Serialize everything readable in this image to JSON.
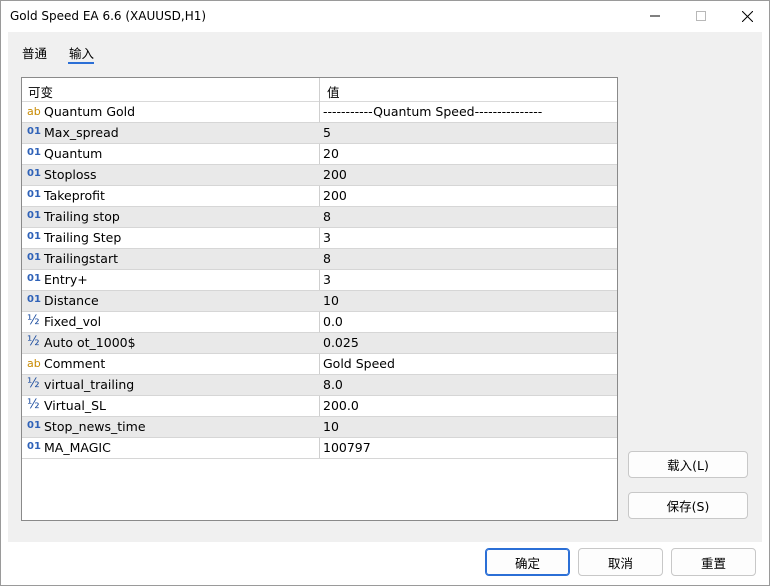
{
  "window": {
    "title": "Gold Speed EA 6.6 (XAUUSD,H1)"
  },
  "tabs": [
    {
      "label": "普通"
    },
    {
      "label": "输入"
    }
  ],
  "grid": {
    "headers": {
      "variable": "可变",
      "value": "值"
    },
    "rows": [
      {
        "type": "ab",
        "icon": "ab",
        "name": "Quantum Gold",
        "value": "-----------Quantum Speed---------------"
      },
      {
        "type": "int",
        "icon": "01",
        "name": "Max_spread",
        "value": "5"
      },
      {
        "type": "int",
        "icon": "01",
        "name": "Quantum",
        "value": "20"
      },
      {
        "type": "int",
        "icon": "01",
        "name": "Stoploss",
        "value": "200"
      },
      {
        "type": "int",
        "icon": "01",
        "name": "Takeprofit",
        "value": "200"
      },
      {
        "type": "int",
        "icon": "01",
        "name": "Trailing stop",
        "value": "8"
      },
      {
        "type": "int",
        "icon": "01",
        "name": "Trailing Step",
        "value": "3"
      },
      {
        "type": "int",
        "icon": "01",
        "name": "Trailingstart",
        "value": "8"
      },
      {
        "type": "int",
        "icon": "01",
        "name": "Entry+",
        "value": "3"
      },
      {
        "type": "int",
        "icon": "01",
        "name": "Distance",
        "value": "10"
      },
      {
        "type": "double",
        "icon": "½",
        "name": "Fixed_vol",
        "value": "0.0"
      },
      {
        "type": "double",
        "icon": "½",
        "name": "Auto ot_1000$",
        "value": "0.025"
      },
      {
        "type": "ab",
        "icon": "ab",
        "name": "Comment",
        "value": "Gold Speed"
      },
      {
        "type": "double",
        "icon": "½",
        "name": "virtual_trailing",
        "value": "8.0"
      },
      {
        "type": "double",
        "icon": "½",
        "name": "Virtual_SL",
        "value": "200.0"
      },
      {
        "type": "int",
        "icon": "01",
        "name": "Stop_news_time",
        "value": "10"
      },
      {
        "type": "int",
        "icon": "01",
        "name": "MA_MAGIC",
        "value": "100797"
      }
    ]
  },
  "side_buttons": {
    "load": "载入(L)",
    "save": "保存(S)"
  },
  "footer_buttons": {
    "ok": "确定",
    "cancel": "取消",
    "reset": "重置"
  },
  "colors": {
    "accent": "#2b6fd6",
    "alt_row": "#e9e9e9",
    "int_icon": "#2f62b8",
    "string_icon": "#c88a00"
  }
}
